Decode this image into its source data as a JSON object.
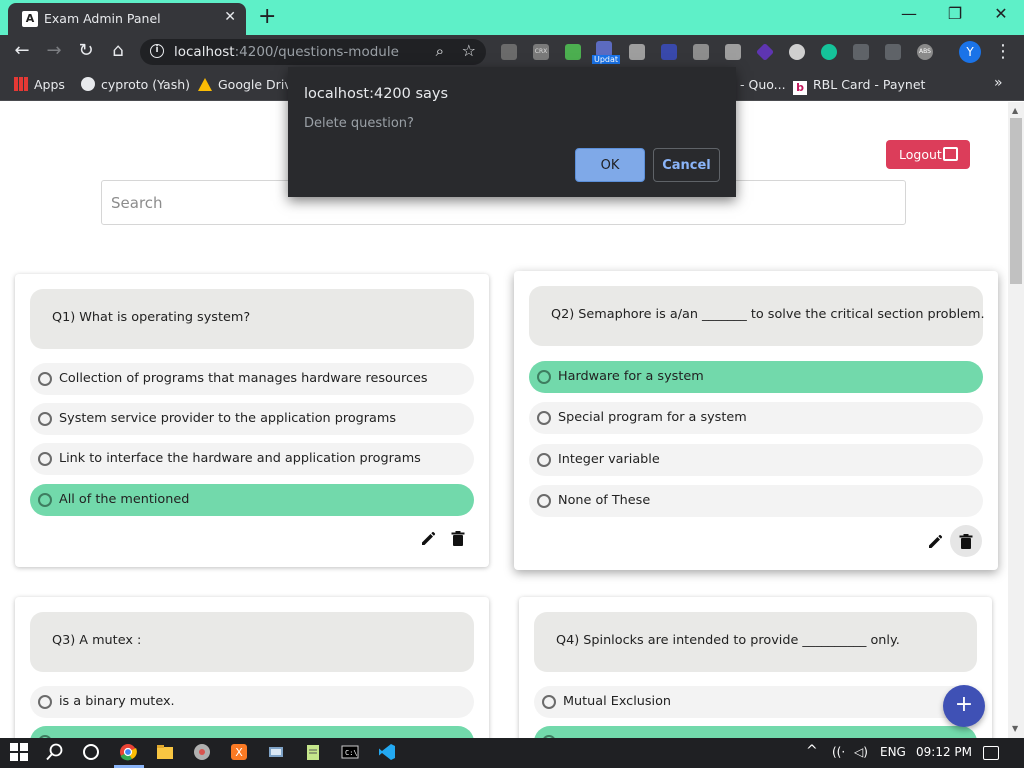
{
  "browser": {
    "tab_title": "Exam Admin Panel",
    "tab_favicon_letter": "A",
    "url_host": "localhost",
    "url_path": ":4200/questions-module",
    "profile_initial": "Y",
    "extension_badge": "Updat",
    "extension_labels": [
      "CRX",
      "ABS"
    ],
    "bookmarks": [
      {
        "label": "Apps",
        "icon": "apps-grid-icon"
      },
      {
        "label": "cyproto (Yash)",
        "icon": "github-icon"
      },
      {
        "label": "Google Drive",
        "icon": "google-drive-icon"
      },
      {
        "label": "- Quo...",
        "icon": "none"
      },
      {
        "label": "RBL Card - Paynet",
        "icon": "rbl-icon"
      }
    ],
    "bookmarks_overflow": "»"
  },
  "dialog": {
    "title": "localhost:4200 says",
    "message": "Delete question?",
    "ok_label": "OK",
    "cancel_label": "Cancel"
  },
  "header": {
    "logout_label": "Logout",
    "search_placeholder": "Search",
    "search_value": ""
  },
  "questions": [
    {
      "text": "Q1) What is operating system?",
      "options": [
        {
          "label": "Collection of programs that manages hardware resources",
          "correct": false
        },
        {
          "label": "System service provider to the application programs",
          "correct": false
        },
        {
          "label": "Link to interface the hardware and application programs",
          "correct": false
        },
        {
          "label": "All of the mentioned",
          "correct": true
        }
      ]
    },
    {
      "text": "Q2) Semaphore is a/an _______ to solve the critical section problem.",
      "options": [
        {
          "label": "Hardware for a system",
          "correct": true
        },
        {
          "label": "Special program for a system",
          "correct": false
        },
        {
          "label": "Integer variable",
          "correct": false
        },
        {
          "label": "None of These",
          "correct": false
        }
      ]
    },
    {
      "text": "Q3) A mutex :",
      "options": [
        {
          "label": "is a binary mutex.",
          "correct": false
        }
      ]
    },
    {
      "text": "Q4) Spinlocks are intended to provide __________ only.",
      "options": [
        {
          "label": "Mutual Exclusion",
          "correct": false
        }
      ]
    }
  ],
  "fab_label": "+",
  "taskbar": {
    "language": "ENG",
    "time": "09:12 PM"
  },
  "colors": {
    "accent": "#3f51b5",
    "logout": "#dc3d5a",
    "correct_option": "#72d9ab",
    "titlebar": "#5ef0c8"
  }
}
